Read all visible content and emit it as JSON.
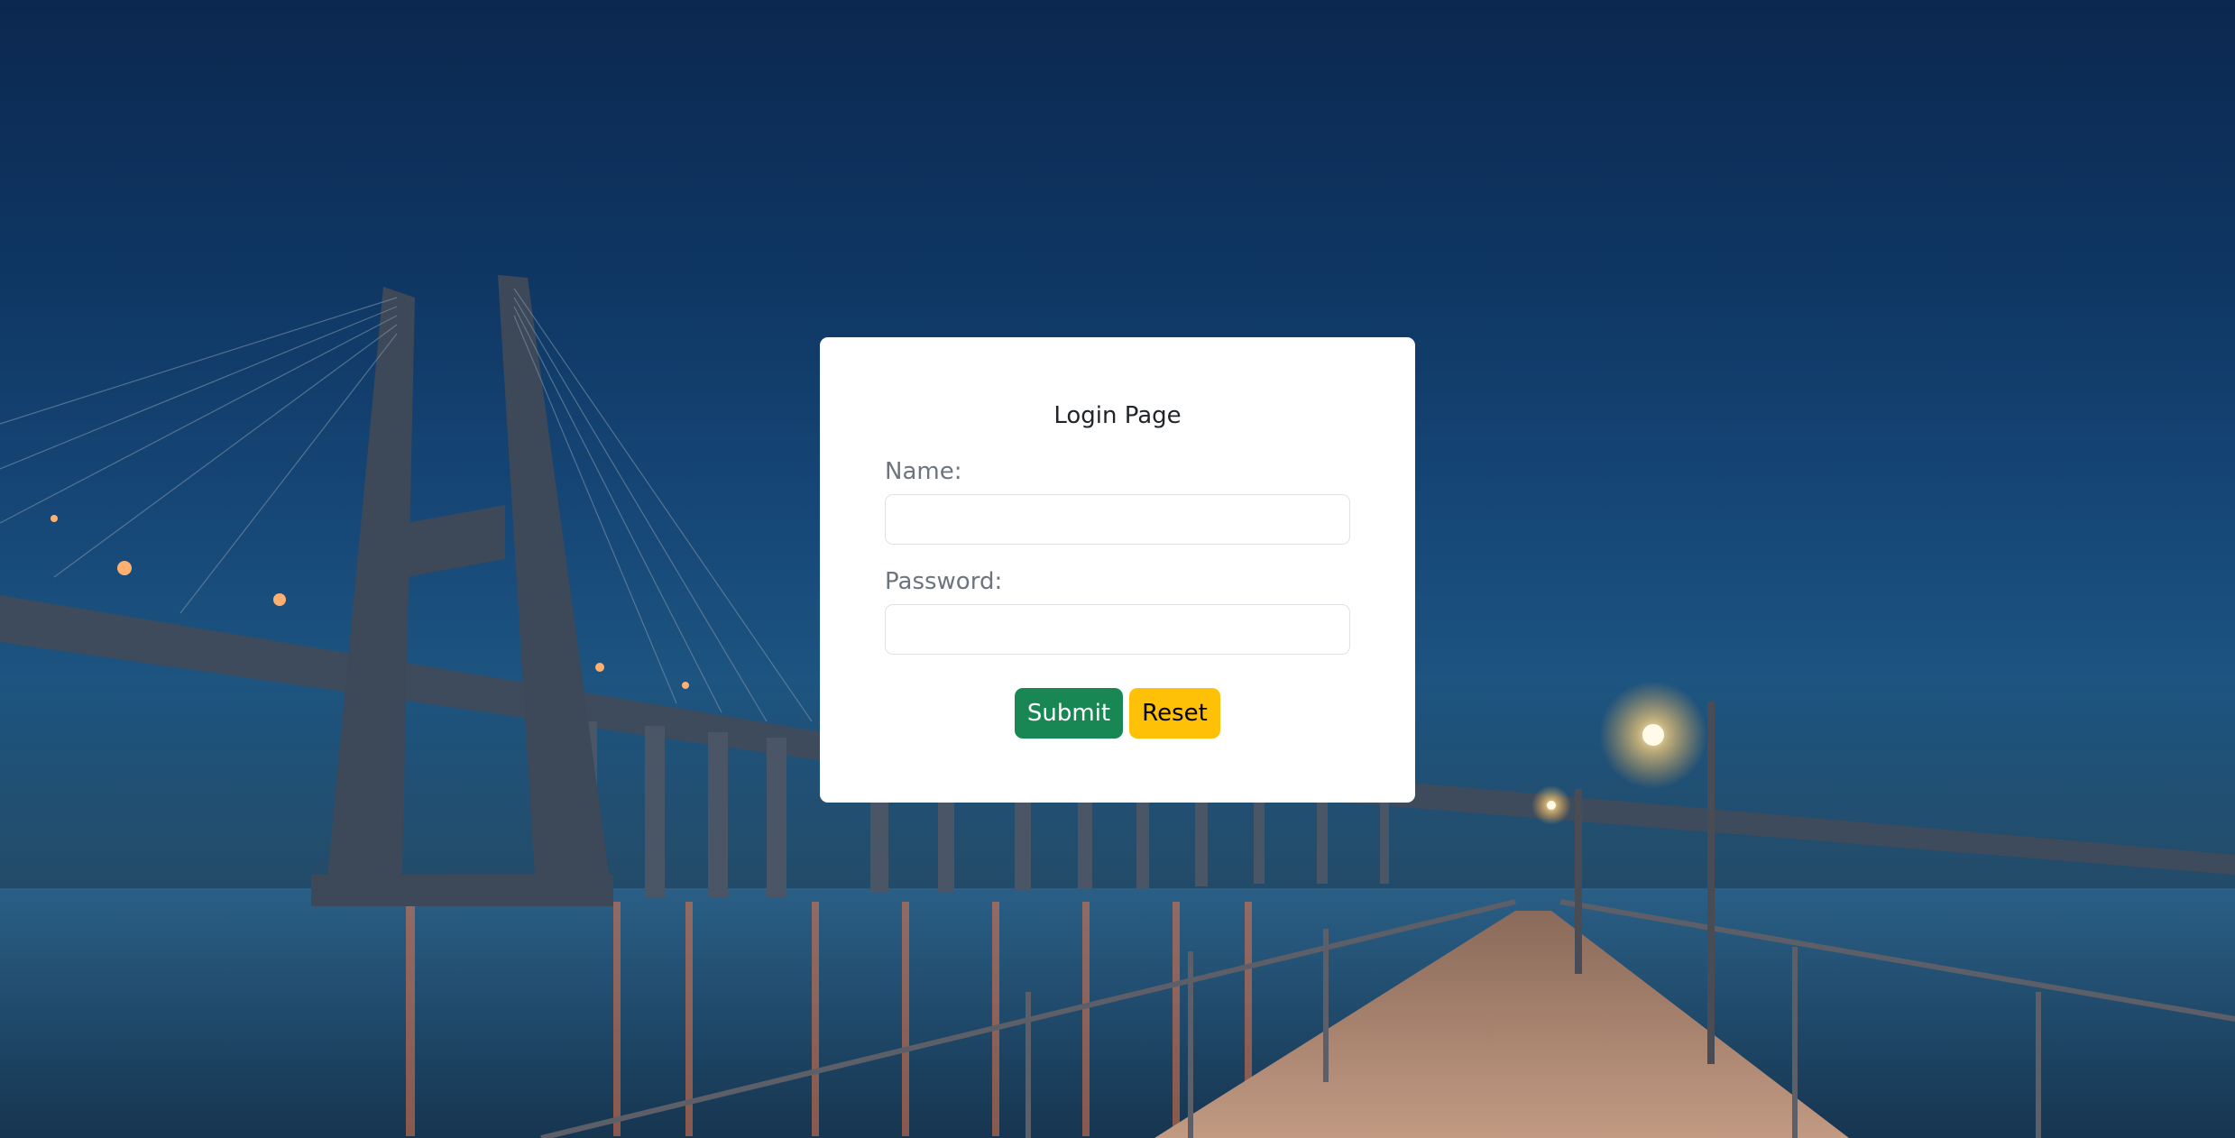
{
  "page": {
    "background_image": "night-bridge-pier-scene",
    "colors": {
      "sky_top": "#0b2850",
      "water": "#1d4566",
      "card_bg": "#ffffff",
      "submit_bg": "#198754",
      "reset_bg": "#ffc107",
      "label_color": "#6c757d"
    }
  },
  "login": {
    "title": "Login Page",
    "name_label": "Name:",
    "name_value": "",
    "name_placeholder": "",
    "password_label": "Password:",
    "password_value": "",
    "password_placeholder": "",
    "submit_label": "Submit",
    "reset_label": "Reset"
  }
}
